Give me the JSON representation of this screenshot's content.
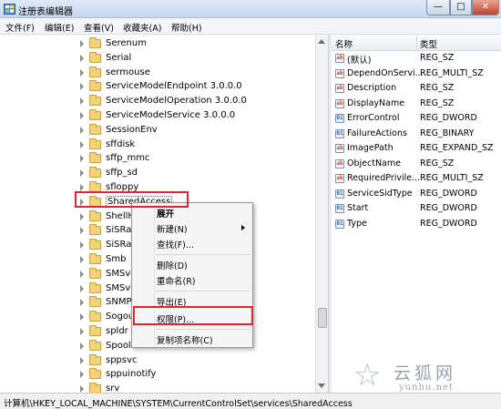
{
  "window": {
    "title": "注册表编辑器",
    "app_icon": "regedit-icon",
    "controls": {
      "minimize": "—",
      "maximize": "□",
      "close": "✕"
    }
  },
  "menubar": {
    "items": [
      "文件(F)",
      "编辑(E)",
      "查看(V)",
      "收藏夹(A)",
      "帮助(H)"
    ]
  },
  "tree": {
    "items": [
      {
        "label": "Serenum"
      },
      {
        "label": "Serial"
      },
      {
        "label": "sermouse"
      },
      {
        "label": "ServiceModelEndpoint 3.0.0.0"
      },
      {
        "label": "ServiceModelOperation 3.0.0.0"
      },
      {
        "label": "ServiceModelService 3.0.0.0"
      },
      {
        "label": "SessionEnv"
      },
      {
        "label": "sffdisk"
      },
      {
        "label": "sffp_mmc"
      },
      {
        "label": "sffp_sd"
      },
      {
        "label": "sfloppy"
      },
      {
        "label": "SharedAccess",
        "selected": true
      },
      {
        "label": "ShellHWDetection"
      },
      {
        "label": "SiSRaid2"
      },
      {
        "label": "SiSRaid4"
      },
      {
        "label": "Smb"
      },
      {
        "label": "SMSvcHost 3.0.0.0"
      },
      {
        "label": "SMSvcHost 4.0.0.0"
      },
      {
        "label": "SNMPTRAP"
      },
      {
        "label": "Sogou"
      },
      {
        "label": "spldr"
      },
      {
        "label": "Spooler"
      },
      {
        "label": "sppsvc"
      },
      {
        "label": "sppuinotify"
      },
      {
        "label": "srv"
      }
    ]
  },
  "values_list": {
    "columns": {
      "name": "名称",
      "type": "类型"
    },
    "rows": [
      {
        "icon": "sz",
        "name": "(默认)",
        "type": "REG_SZ"
      },
      {
        "icon": "sz",
        "name": "DependOnServi...",
        "type": "REG_MULTI_SZ"
      },
      {
        "icon": "sz",
        "name": "Description",
        "type": "REG_SZ"
      },
      {
        "icon": "sz",
        "name": "DisplayName",
        "type": "REG_SZ"
      },
      {
        "icon": "bin",
        "name": "ErrorControl",
        "type": "REG_DWORD"
      },
      {
        "icon": "bin",
        "name": "FailureActions",
        "type": "REG_BINARY"
      },
      {
        "icon": "sz",
        "name": "ImagePath",
        "type": "REG_EXPAND_SZ"
      },
      {
        "icon": "sz",
        "name": "ObjectName",
        "type": "REG_SZ"
      },
      {
        "icon": "sz",
        "name": "RequiredPrivile...",
        "type": "REG_MULTI_SZ"
      },
      {
        "icon": "bin",
        "name": "ServiceSidType",
        "type": "REG_DWORD"
      },
      {
        "icon": "bin",
        "name": "Start",
        "type": "REG_DWORD"
      },
      {
        "icon": "bin",
        "name": "Type",
        "type": "REG_DWORD"
      }
    ]
  },
  "context_menu": {
    "expand": "展开",
    "new": "新建(N)",
    "find": "查找(F)...",
    "delete": "删除(D)",
    "rename": "重命名(R)",
    "export": "导出(E)",
    "permissions": "权限(P)...",
    "copy_key_name": "复制项名称(C)"
  },
  "statusbar": {
    "path": "计算机\\HKEY_LOCAL_MACHINE\\SYSTEM\\CurrentControlSet\\services\\SharedAccess"
  },
  "watermark": {
    "brand": "云狐网",
    "url": "yunhu.net"
  },
  "colors": {
    "highlight": "#e0262b",
    "folder": "#f3d27b"
  }
}
